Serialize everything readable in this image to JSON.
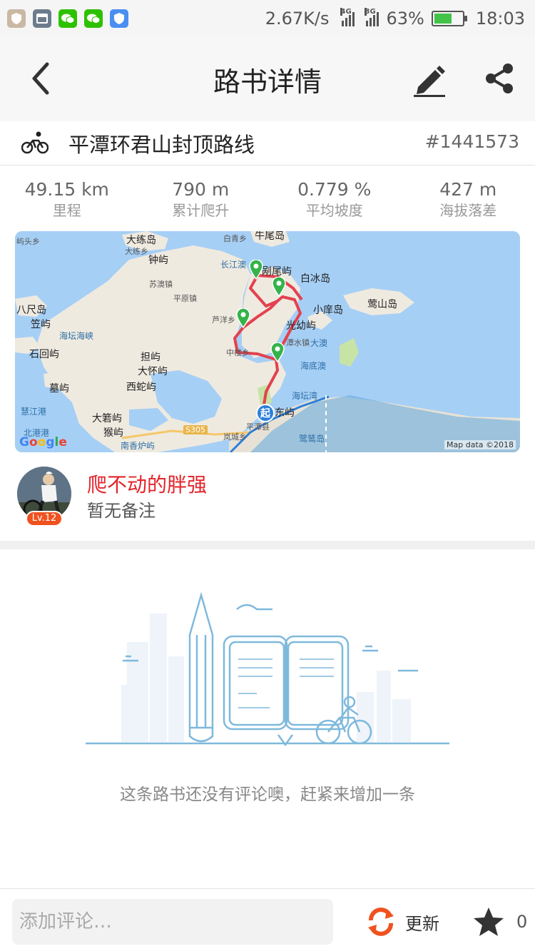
{
  "status_bar": {
    "speed": "2.67K/s",
    "net1": "4G",
    "net2": "3G",
    "battery_percent": "63%",
    "battery_level": 0.63,
    "time": "18:03",
    "notif_icons": [
      "shield-app-icon",
      "gallery-icon",
      "wechat-icon",
      "wechat-icon",
      "security-icon"
    ]
  },
  "nav": {
    "title": "路书详情"
  },
  "route": {
    "name": "平潭环君山封顶路线",
    "id": "#1441573"
  },
  "stats": [
    {
      "value": "49.15 km",
      "label": "里程"
    },
    {
      "value": "790 m",
      "label": "累计爬升"
    },
    {
      "value": "0.779 %",
      "label": "平均坡度"
    },
    {
      "value": "427 m",
      "label": "海拔落差"
    }
  ],
  "map": {
    "labels": {
      "l1": "屿头乡",
      "l2": "大练岛",
      "l3": "大练乡",
      "l4": "白青乡",
      "l5": "牛尾岛",
      "l6": "钟屿",
      "l7": "长江澳",
      "l8": "剐尾屿",
      "l9": "白冰岛",
      "l10": "苏澳镇",
      "l11": "平原镇",
      "l12": "小庠岛",
      "l13": "莺山岛",
      "l14": "八尺岛",
      "l15": "芦洋乡",
      "l16": "笠屿",
      "l17": "光幼屿",
      "l18": "海坛海峡",
      "l19": "潭水镇",
      "l20": "大澳",
      "l21": "石回屿",
      "l22": "中楼乡",
      "l23": "担屿",
      "l24": "海底澳",
      "l25": "大怀屿",
      "l26": "西蛇屿",
      "l27": "墓屿",
      "l28": "海坛湾",
      "l29": "慧江港",
      "l30": "大箬屿",
      "l31": "北港港",
      "l32": "猴屿",
      "l33": "S305",
      "l34": "平潭县",
      "l35": "岚城乡",
      "l36": "南香炉屿",
      "l37": "鹭鸶岛",
      "l38": "东屿"
    },
    "start_label": "起",
    "google": [
      "G",
      "o",
      "o",
      "g",
      "l",
      "e"
    ],
    "credit": "Map data ©2018"
  },
  "user": {
    "name": "爬不动的胖强",
    "note": "暂无备注",
    "level": "Lv.12"
  },
  "empty": {
    "message": "这条路书还没有评论噢，赶紧来增加一条"
  },
  "bottom": {
    "comment_placeholder": "添加评论…",
    "update_label": "更新",
    "star_count": "0"
  },
  "colors": {
    "route_line": "#e3414f",
    "pin": "#35b34a",
    "accent_red": "#e4242a",
    "level_badge": "#f0521f",
    "update_icon": "#f0521f"
  }
}
